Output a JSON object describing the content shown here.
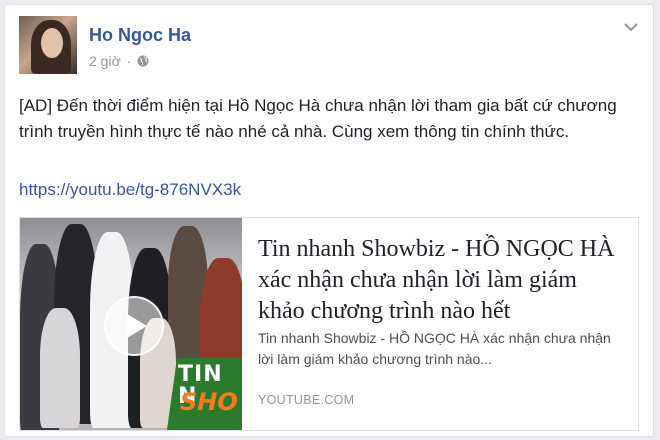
{
  "post": {
    "author": "Ho Ngoc Ha",
    "time": "2 giờ",
    "separator": "·",
    "audience_icon": "globe-icon",
    "menu_icon": "chevron-down-icon",
    "text": "[AD] Đến thời điểm hiện tại Hồ Ngọc Hà chưa nhận lời tham gia bất cứ chương trình truyền hình thực tế nào nhé cả nhà. Cùng xem thông tin chính thức.",
    "link": "https://youtu.be/tg-876NVX3k"
  },
  "link_card": {
    "title": "Tin nhanh Showbiz - HỒ NGỌC HÀ xác nhận chưa nhận lời làm giám khảo chương trình nào hết",
    "description": "Tin nhanh Showbiz - HỒ NGỌC HÀ xác nhận chưa nhận lời làm giám khảo chương trình nào...",
    "source": "YOUTUBE.COM",
    "thumbnail_icon": "play-icon",
    "thumbnail_text_1": "TIN N",
    "thumbnail_text_2": "SHO"
  },
  "colors": {
    "link_blue": "#365899",
    "text": "#1d2129",
    "muted": "#90949c",
    "page_bg": "#e9ebee"
  }
}
